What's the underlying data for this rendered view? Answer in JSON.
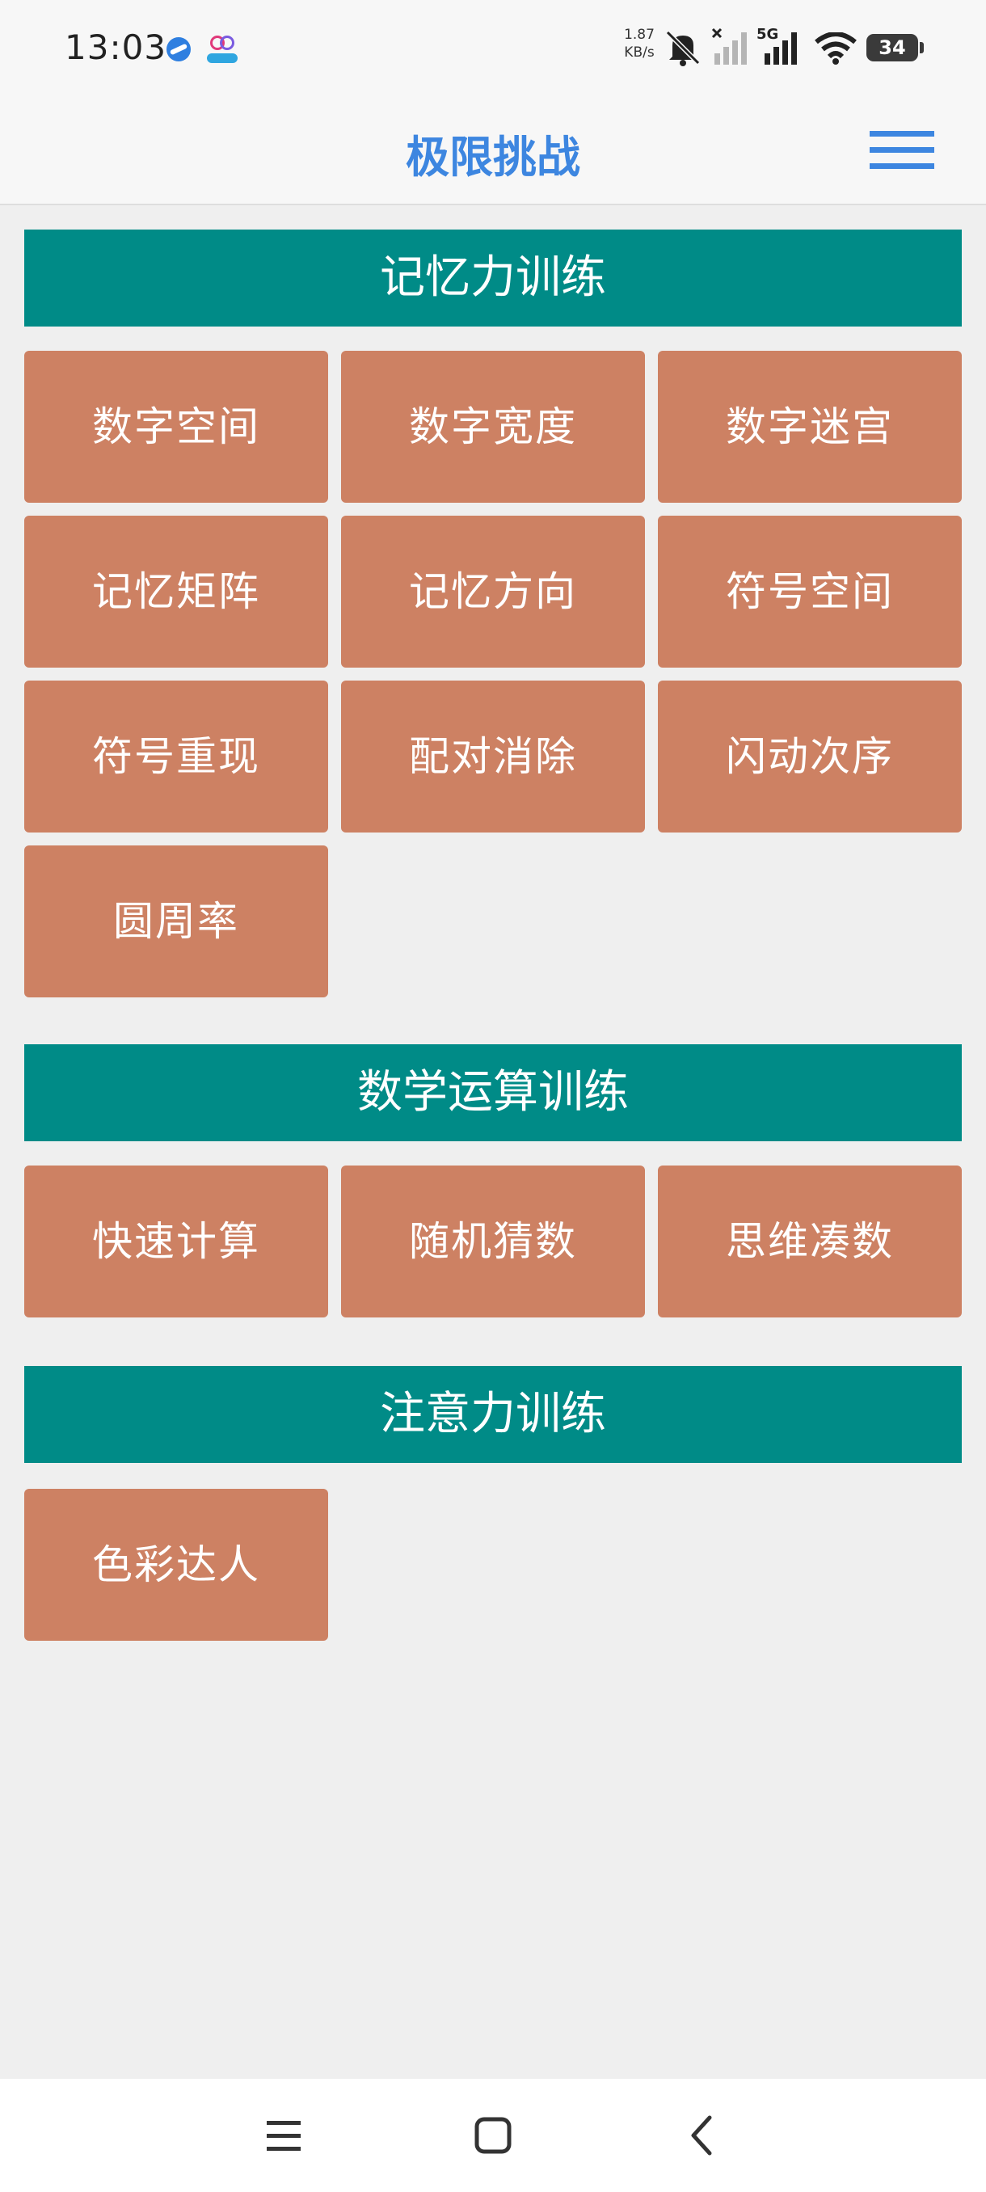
{
  "status_bar": {
    "time": "13:03",
    "speed_value": "1.87",
    "speed_unit": "KB/s",
    "network": "5G",
    "battery": "34"
  },
  "header": {
    "title": "极限挑战",
    "menu_icon": "hamburger-menu-icon"
  },
  "sections": {
    "memory": {
      "title": "记忆力训练",
      "items": [
        "数字空间",
        "数字宽度",
        "数字迷宫",
        "记忆矩阵",
        "记忆方向",
        "符号空间",
        "符号重现",
        "配对消除",
        "闪动次序",
        "圆周率"
      ]
    },
    "math": {
      "title": "数学运算训练",
      "items": [
        "快速计算",
        "随机猜数",
        "思维凑数"
      ]
    },
    "attention": {
      "title": "注意力训练",
      "items": [
        "色彩达人"
      ]
    }
  },
  "nav": {
    "recents_icon": "recents-icon",
    "home_icon": "home-icon",
    "back_icon": "back-icon"
  },
  "colors": {
    "accent": "#3d86e0",
    "section_header": "#008b87",
    "tile": "#cd8163",
    "background": "#efefef"
  }
}
